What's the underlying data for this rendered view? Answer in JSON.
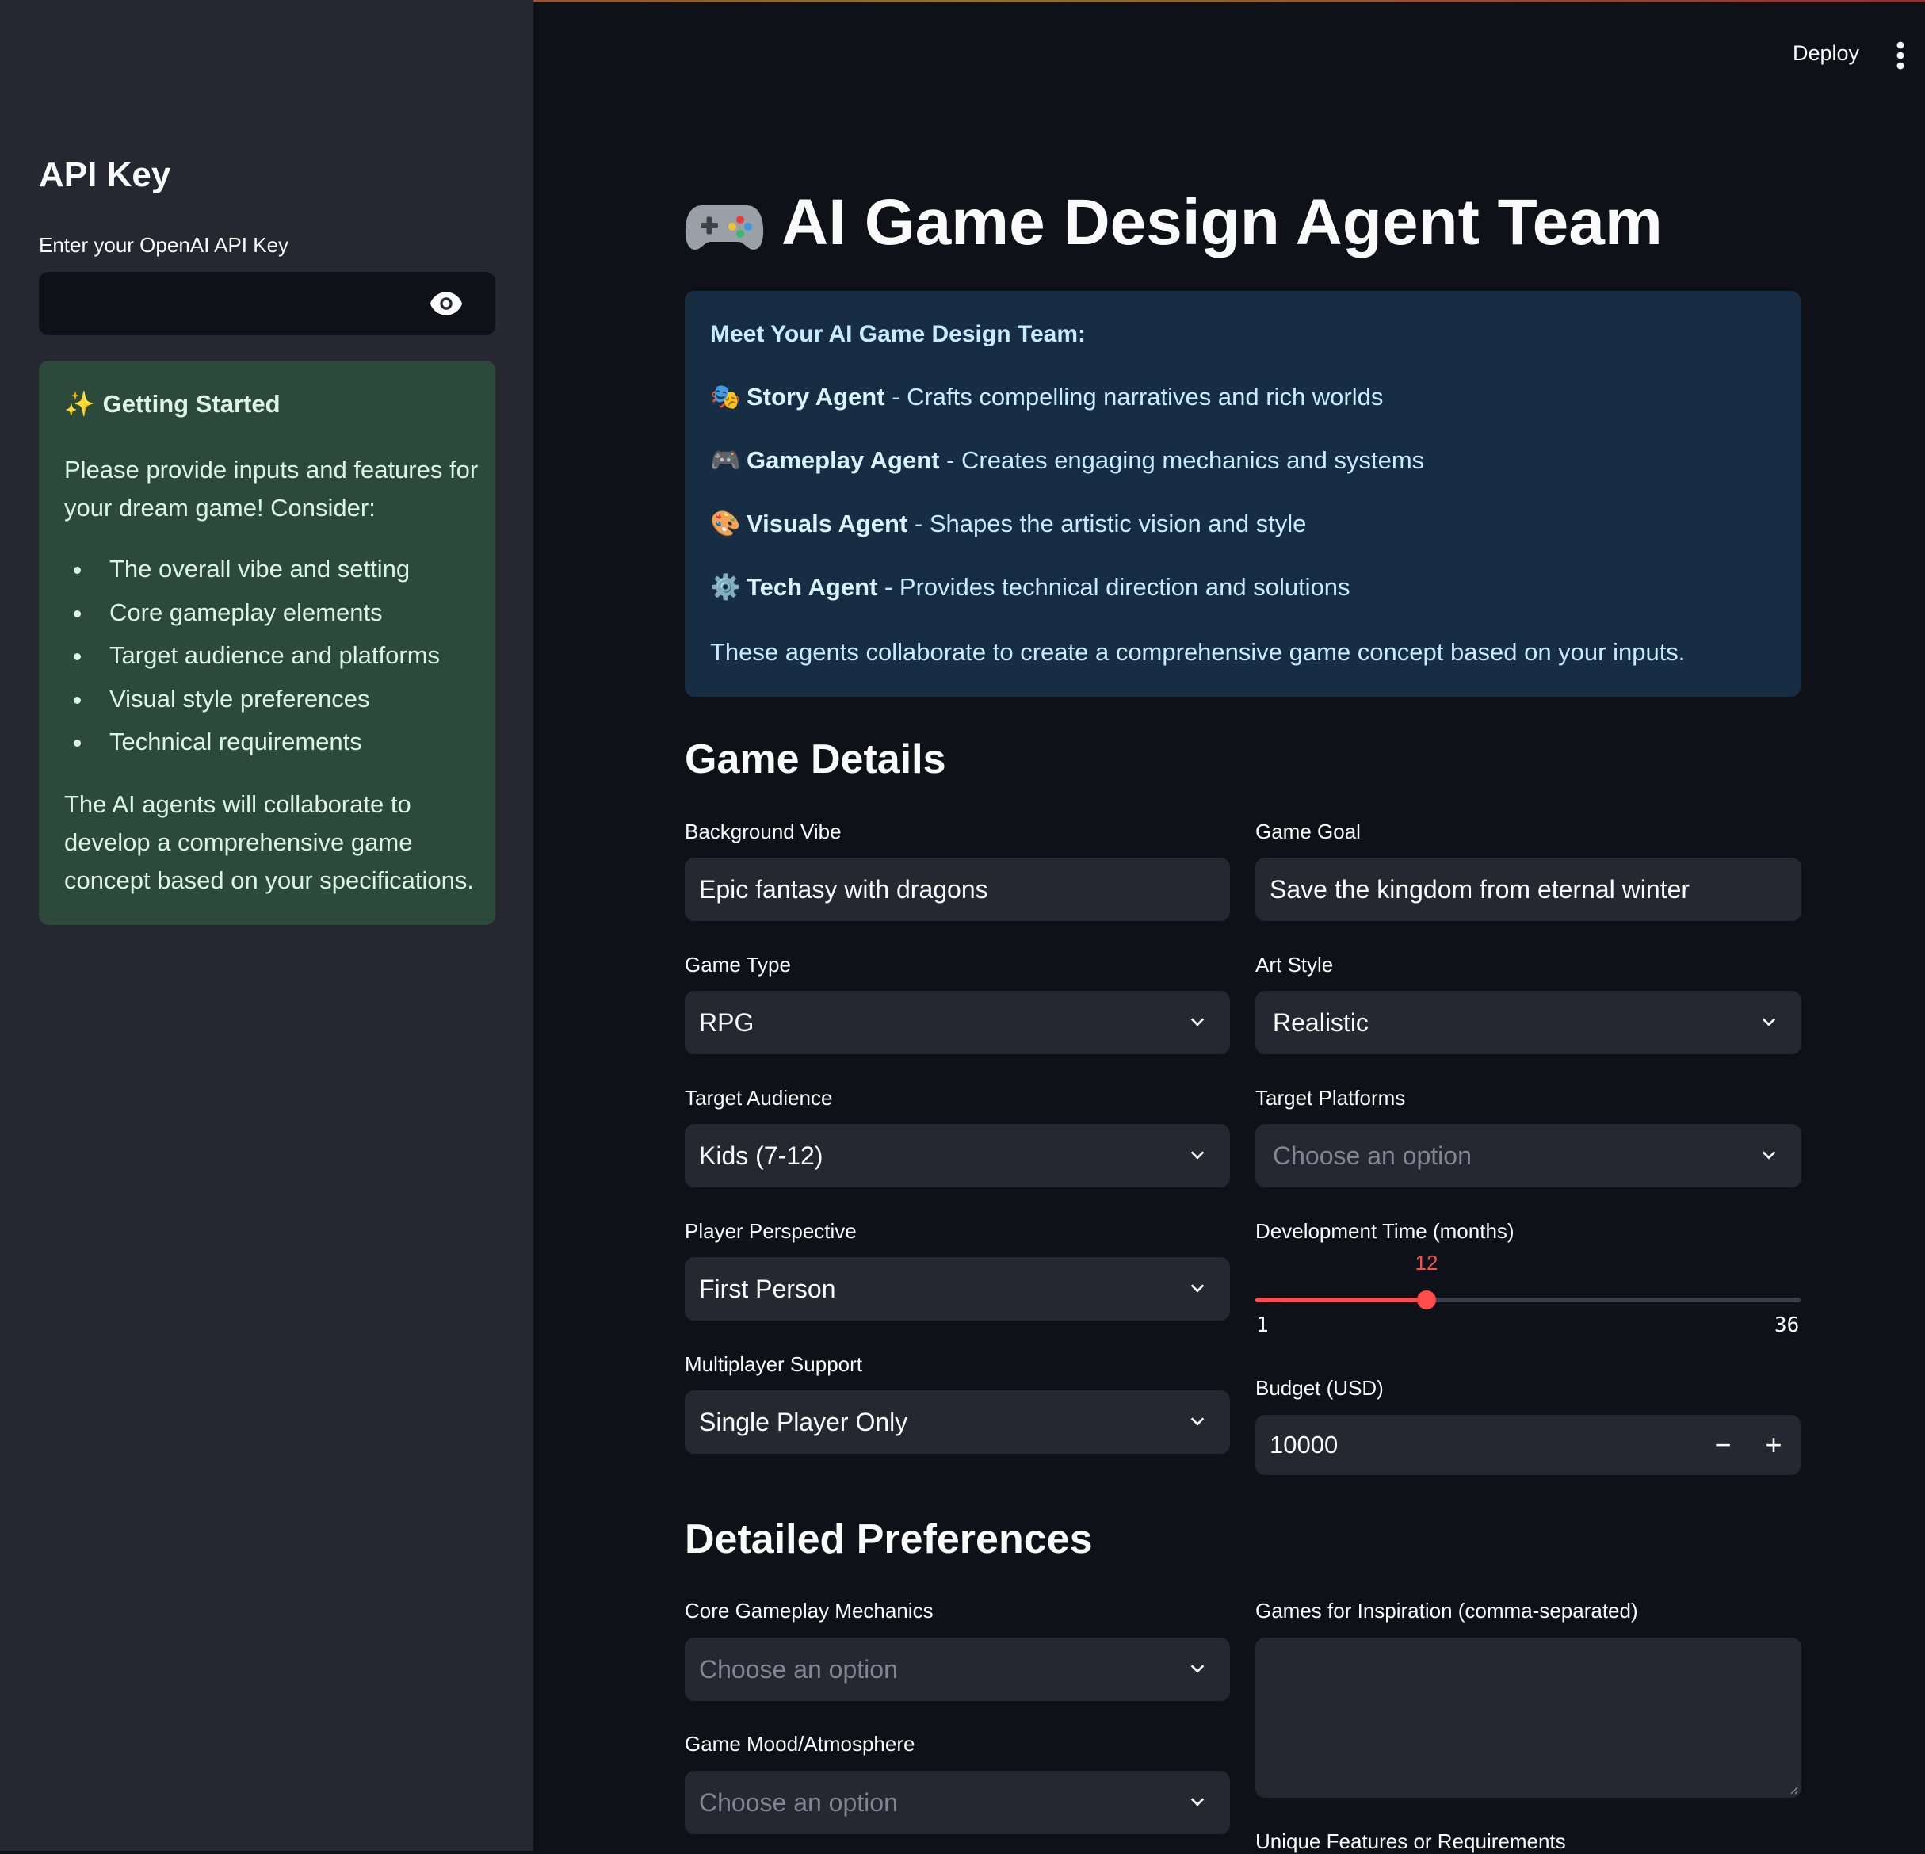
{
  "sidebar": {
    "title": "API Key",
    "api_label": "Enter your OpenAI API Key",
    "api_value": "",
    "getting_started": {
      "title": "Getting Started",
      "intro": "Please provide inputs and features for your dream game! Consider:",
      "items": [
        "The overall vibe and setting",
        "Core gameplay elements",
        "Target audience and platforms",
        "Visual style preferences",
        "Technical requirements"
      ],
      "outro": "The AI agents will collaborate to develop a comprehensive game concept based on your specifications."
    }
  },
  "header": {
    "deploy_label": "Deploy"
  },
  "main": {
    "title": "AI Game Design Agent Team",
    "team": {
      "heading": "Meet Your AI Game Design Team:",
      "agents": [
        {
          "icon": "🎭",
          "name": "Story Agent",
          "desc": " - Crafts compelling narratives and rich worlds"
        },
        {
          "icon": "🎮",
          "name": "Gameplay Agent",
          "desc": " - Creates engaging mechanics and systems"
        },
        {
          "icon": "🎨",
          "name": "Visuals Agent",
          "desc": " - Shapes the artistic vision and style"
        },
        {
          "icon": "⚙️",
          "name": "Tech Agent",
          "desc": " - Provides technical direction and solutions"
        }
      ],
      "footer": "These agents collaborate to create a comprehensive game concept based on your inputs."
    },
    "game_details": {
      "heading": "Game Details",
      "background_vibe": {
        "label": "Background Vibe",
        "value": "Epic fantasy with dragons"
      },
      "game_goal": {
        "label": "Game Goal",
        "value": "Save the kingdom from eternal winter"
      },
      "game_type": {
        "label": "Game Type",
        "value": "RPG"
      },
      "art_style": {
        "label": "Art Style",
        "value": "Realistic"
      },
      "target_audience": {
        "label": "Target Audience",
        "value": "Kids (7-12)"
      },
      "target_platforms": {
        "label": "Target Platforms",
        "placeholder": "Choose an option"
      },
      "player_perspective": {
        "label": "Player Perspective",
        "value": "First Person"
      },
      "dev_time": {
        "label": "Development Time (months)",
        "value": 12,
        "min": 1,
        "max": 36,
        "value_text": "12",
        "min_text": "1",
        "max_text": "36"
      },
      "multiplayer": {
        "label": "Multiplayer Support",
        "value": "Single Player Only"
      },
      "budget": {
        "label": "Budget (USD)",
        "value": "10000",
        "minus": "−",
        "plus": "+"
      }
    },
    "detailed_prefs": {
      "heading": "Detailed Preferences",
      "core_mechanics": {
        "label": "Core Gameplay Mechanics",
        "placeholder": "Choose an option"
      },
      "inspiration": {
        "label": "Games for Inspiration (comma-separated)",
        "value": ""
      },
      "mood": {
        "label": "Game Mood/Atmosphere",
        "placeholder": "Choose an option"
      },
      "unique_features": {
        "label": "Unique Features or Requirements"
      }
    }
  },
  "colors": {
    "accent": "#ff4b4b",
    "sidebar_bg": "#262730",
    "main_bg": "#0e1117",
    "info_bg": "#172d43",
    "success_bg": "#2c4a3b"
  }
}
